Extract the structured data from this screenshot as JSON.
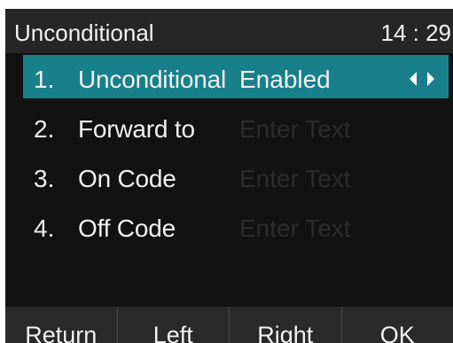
{
  "header": {
    "title": "Unconditional",
    "time": "14 : 29"
  },
  "menu": {
    "items": [
      {
        "number": "1.",
        "label": "Unconditional",
        "value": "Enabled",
        "placeholder": "",
        "selected": true
      },
      {
        "number": "2.",
        "label": "Forward to",
        "value": "",
        "placeholder": "Enter Text",
        "selected": false
      },
      {
        "number": "3.",
        "label": "On Code",
        "value": "",
        "placeholder": "Enter Text",
        "selected": false
      },
      {
        "number": "4.",
        "label": "Off Code",
        "value": "",
        "placeholder": "Enter Text",
        "selected": false
      }
    ],
    "selector_icons": [
      "arrow-left-icon",
      "arrow-right-icon"
    ]
  },
  "softkeys": {
    "return": "Return",
    "left": "Left",
    "right": "Right",
    "ok": "OK"
  },
  "colors": {
    "highlight": "#18808a",
    "background": "#121212",
    "header": "#262626",
    "placeholder_text": "#2c2c2c"
  }
}
